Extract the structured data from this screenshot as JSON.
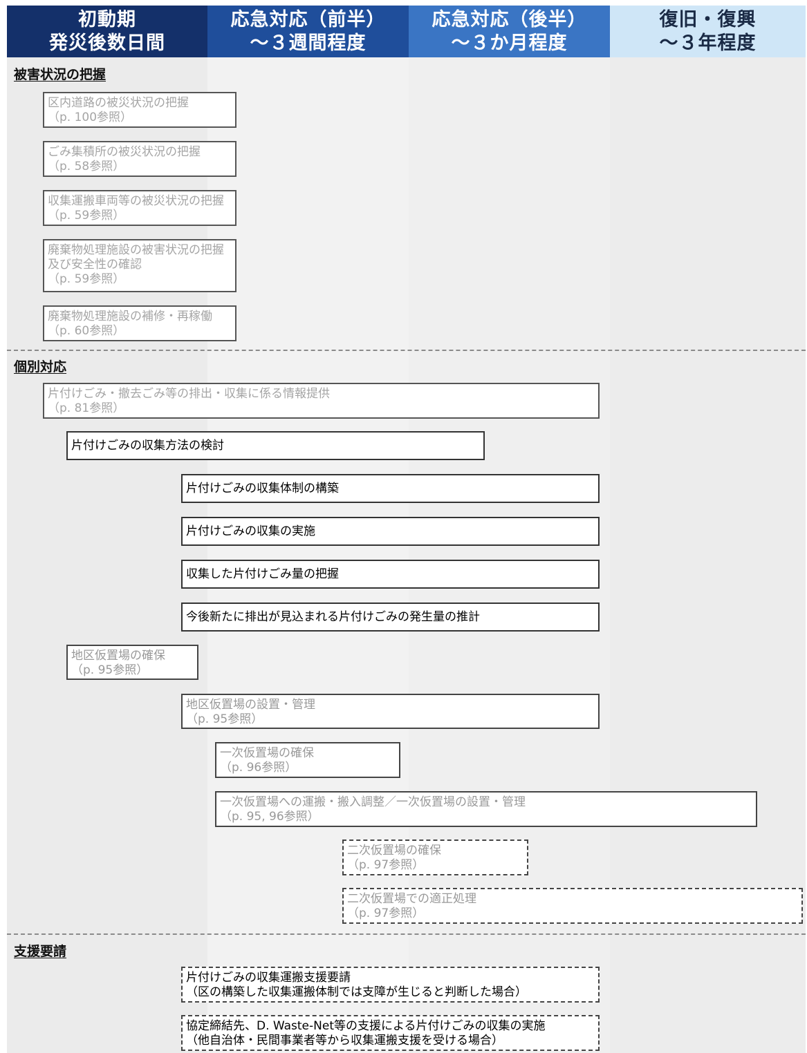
{
  "headers": [
    {
      "line1": "初動期",
      "line2": "発災後数日間",
      "bg": "#14306a",
      "fg": "#ffffff"
    },
    {
      "line1": "応急対応（前半）",
      "line2": "～３週間程度",
      "bg": "#1f4e9b",
      "fg": "#ffffff"
    },
    {
      "line1": "応急対応（後半）",
      "line2": "～３か月程度",
      "bg": "#3a75c4",
      "fg": "#ffffff"
    },
    {
      "line1": "復旧・復興",
      "line2": "～３年程度",
      "bg": "#cfe6f7",
      "fg": "#1a2a45"
    }
  ],
  "column_bg": [
    "#ebebeb",
    "#f1f1f1",
    "#efefef",
    "#ececec"
  ],
  "sections": {
    "damage": "被害状況の把握",
    "individual": "個別対応",
    "support": "支援要請"
  },
  "boxes": {
    "b1": {
      "l1": "区内道路の被災状況の把握",
      "l2": "（p. 100参照）"
    },
    "b2": {
      "l1": "ごみ集積所の被災状況の把握",
      "l2": "（p. 58参照）"
    },
    "b3": {
      "l1": "収集運搬車両等の被災状況の把握",
      "l2": "（p. 59参照）"
    },
    "b4": {
      "l1": "廃棄物処理施設の被害状況の把握",
      "l2": "及び安全性の確認",
      "l3": "（p. 59参照）"
    },
    "b5": {
      "l1": "廃棄物処理施設の補修・再稼働",
      "l2": "（p. 60参照）"
    },
    "b6": {
      "l1": "片付けごみ・撤去ごみ等の排出・収集に係る情報提供",
      "l2": "（p. 81参照）"
    },
    "b7": {
      "l1": "片付けごみの収集方法の検討"
    },
    "b8": {
      "l1": "片付けごみの収集体制の構築"
    },
    "b9": {
      "l1": "片付けごみの収集の実施"
    },
    "b10": {
      "l1": "収集した片付けごみ量の把握"
    },
    "b11": {
      "l1": "今後新たに排出が見込まれる片付けごみの発生量の推計"
    },
    "b12": {
      "l1": "地区仮置場の確保",
      "l2": "（p. 95参照）"
    },
    "b13": {
      "l1": "地区仮置場の設置・管理",
      "l2": "（p. 95参照）"
    },
    "b14": {
      "l1": "一次仮置場の確保",
      "l2": "（p. 96参照）"
    },
    "b15": {
      "l1": "一次仮置場への運搬・搬入調整／一次仮置場の設置・管理",
      "l2": "（p. 95, 96参照）"
    },
    "b16": {
      "l1": "二次仮置場の確保",
      "l2": "（p. 97参照）"
    },
    "b17": {
      "l1": "二次仮置場での適正処理",
      "l2": "（p. 97参照）"
    },
    "b18": {
      "l1": "片付けごみの収集運搬支援要請",
      "l2": "（区の構築した収集運搬体制では支障が生じると判断した場合）"
    },
    "b19": {
      "l1": "協定締結先、D. Waste-Net等の支援による片付けごみの収集の実施",
      "l2": "（他自治体・民間事業者等から収集運搬支援を受ける場合）"
    }
  }
}
